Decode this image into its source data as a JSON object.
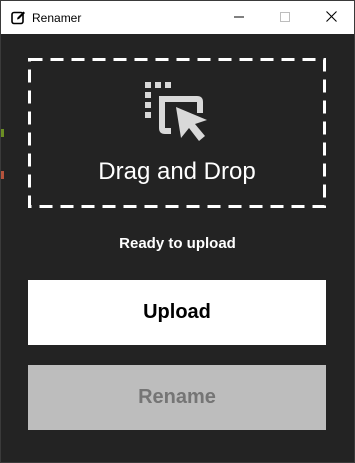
{
  "window": {
    "title": "Renamer",
    "controls": [
      "minimize",
      "maximize",
      "close"
    ]
  },
  "icons": {
    "app": "edit-note-icon",
    "dropzone": "drag-select-cursor-icon",
    "minimize": "minimize-icon",
    "maximize": "maximize-icon",
    "close": "close-icon"
  },
  "dropzone": {
    "label": "Drag and Drop"
  },
  "status": {
    "text": "Ready to upload"
  },
  "buttons": {
    "upload": "Upload",
    "rename": "Rename"
  },
  "colors": {
    "background": "#232323",
    "titlebar": "#ffffff",
    "upload_bg": "#ffffff",
    "rename_bg": "#bdbdbd",
    "rename_text": "#757575",
    "accent_text": "#ffffff"
  }
}
